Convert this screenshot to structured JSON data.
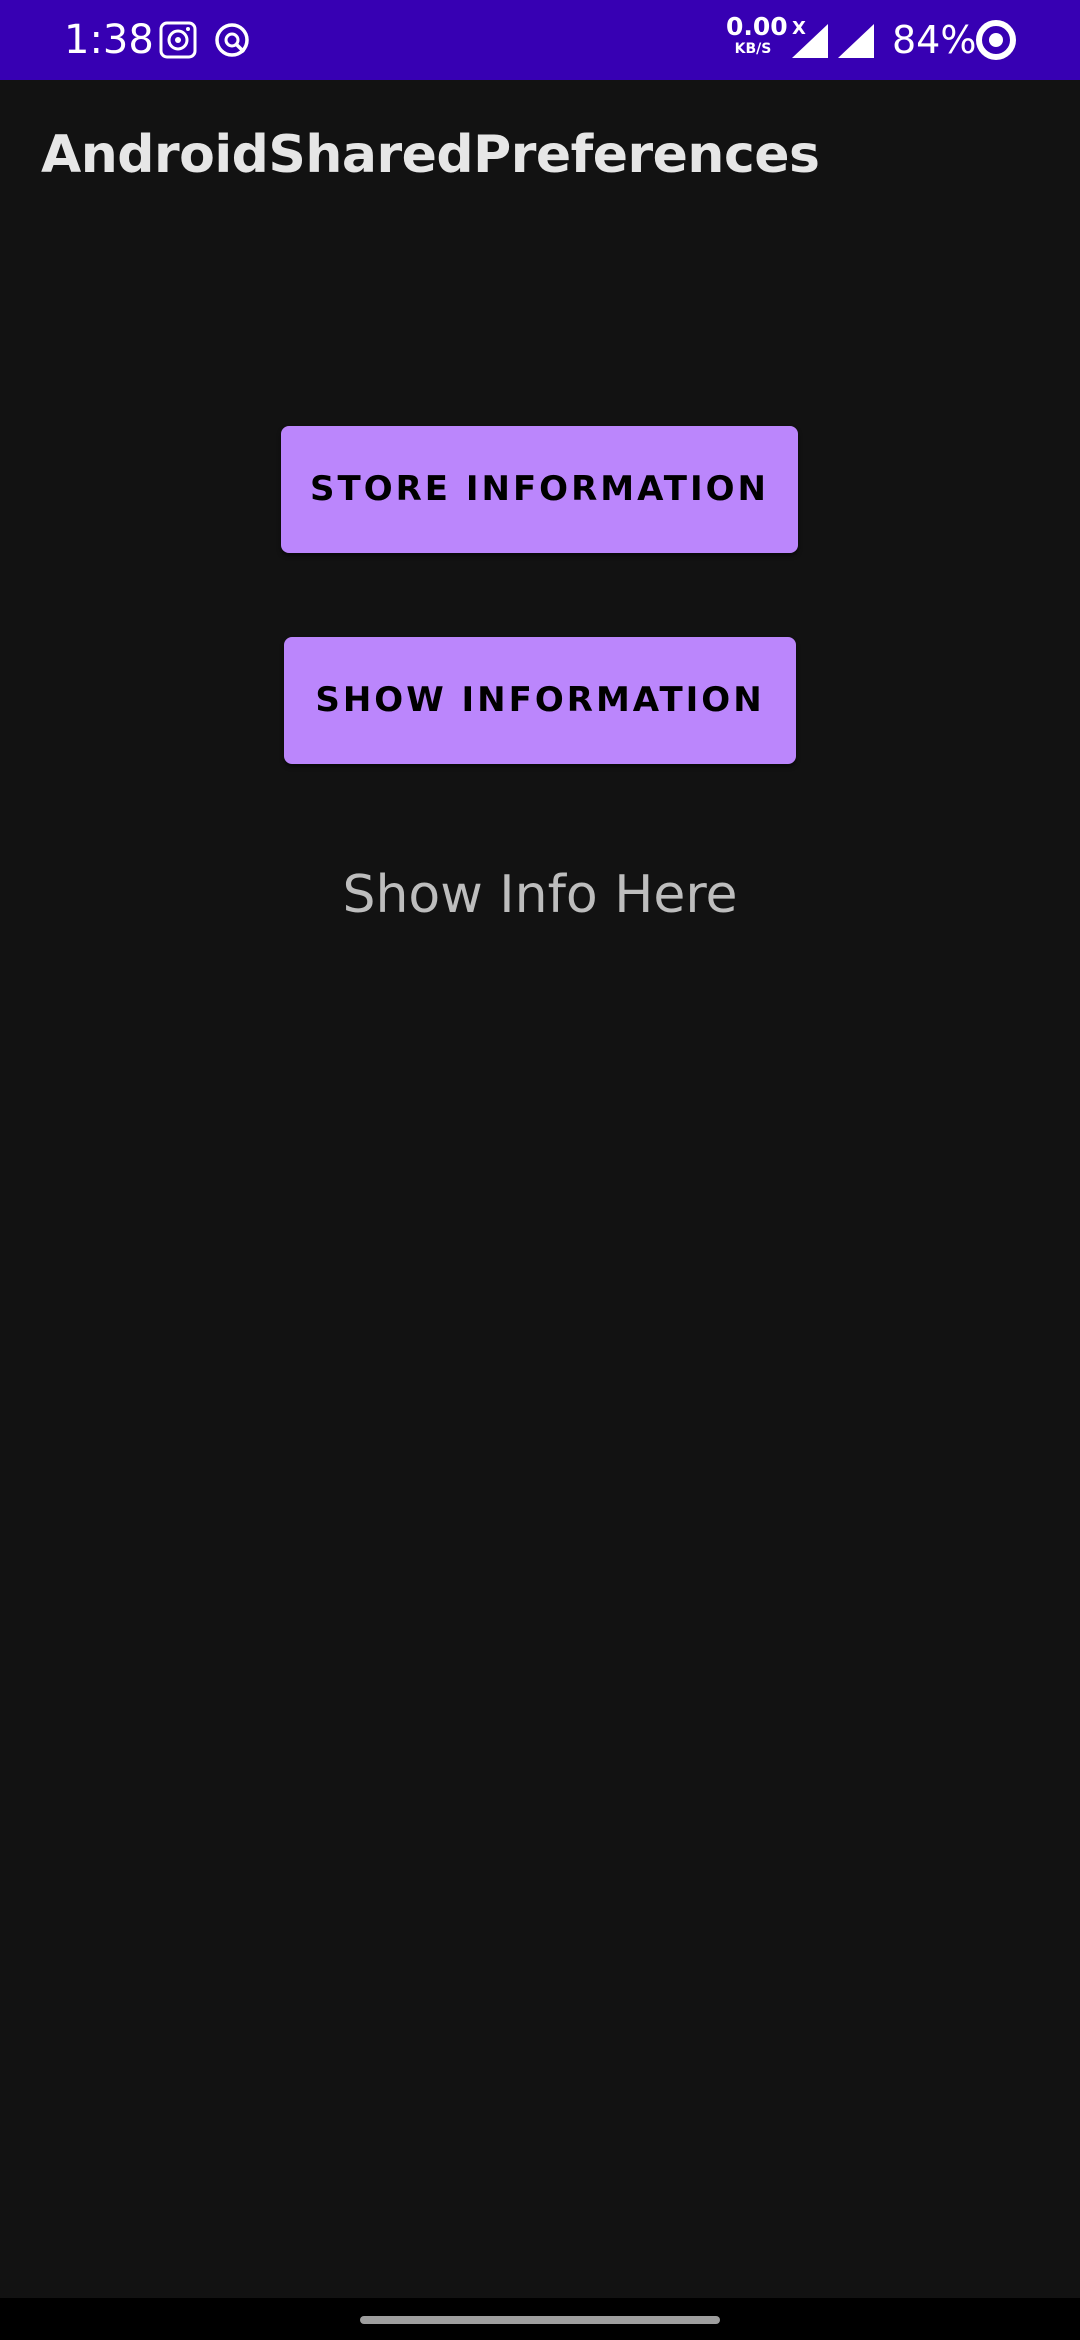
{
  "status_bar": {
    "time": "1:38",
    "network_speed_value": "0.00",
    "network_speed_unit": "KB/S",
    "no_data_mark": "X",
    "battery_percent": "84%",
    "background_color": "#3700b3",
    "icons": [
      "media-player-icon",
      "vpn-icon",
      "signal-icon",
      "signal-icon",
      "battery-saver-icon"
    ]
  },
  "app_bar": {
    "title": "AndroidSharedPreferences"
  },
  "main": {
    "store_button_label": "STORE INFORMATION",
    "show_button_label": "SHOW INFORMATION",
    "info_text": "Show Info Here"
  },
  "theme": {
    "background": "#121212",
    "button_color": "#bb86fc",
    "button_text_color": "#000000",
    "title_color": "#e6e6e6",
    "info_text_color": "#bdbdbd"
  }
}
